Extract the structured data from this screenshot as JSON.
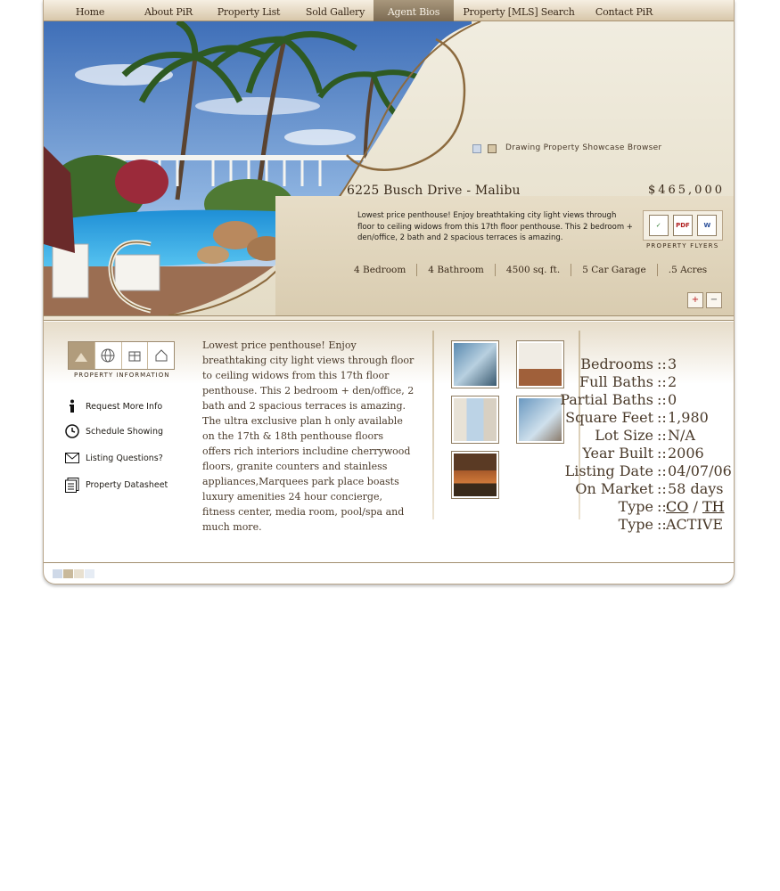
{
  "nav": {
    "items": [
      {
        "label": "Home"
      },
      {
        "label": "About PiR"
      },
      {
        "label": "Property List"
      },
      {
        "label": "Sold Gallery"
      },
      {
        "label": "Agent Bios"
      },
      {
        "label": "Property [MLS] Search"
      },
      {
        "label": "Contact PiR"
      }
    ],
    "active": "Agent Bios"
  },
  "hero": {
    "browser_label": "Drawing Property Showcase Browser",
    "address": "6225 Busch Drive - Malibu",
    "price": "$465,000",
    "short_description": "Lowest price penthouse! Enjoy breathtaking city light views through floor to ceiling widows from this 17th floor penthouse. This 2 bedroom + den/office, 2 bath and 2 spacious terraces is amazing.",
    "flyers_label": "PROPERTY FLYERS",
    "flyer_icons": [
      "print-icon",
      "pdf-icon",
      "word-icon"
    ],
    "specs": [
      "4 Bedroom",
      "4 Bathroom",
      "4500 sq. ft.",
      "5 Car Garage",
      ".5 Acres"
    ]
  },
  "sidebar": {
    "info_label": "PROPERTY INFORMATION",
    "links": [
      {
        "label": "Request More Info",
        "icon": "info-icon"
      },
      {
        "label": "Schedule Showing",
        "icon": "clock-icon"
      },
      {
        "label": "Listing Questions?",
        "icon": "envelope-icon"
      },
      {
        "label": "Property Datasheet",
        "icon": "datasheet-icon"
      }
    ]
  },
  "description": "Lowest price penthouse! Enjoy breathtaking city light views through floor to ceiling widows from this 17th floor penthouse. This 2 bedroom + den/office, 2 bath and 2 spacious terraces is amazing. The ultra exclusive plan h only available on the 17th & 18th penthouse floors offers rich interiors includine cherrywood floors, granite counters and stainless appliances,Marquees park place boasts luxury amenities 24 hour concierge, fitness center, media room, pool/spa and much more.",
  "facts": [
    {
      "key": "Bedrooms",
      "value": "3"
    },
    {
      "key": "Full Baths",
      "value": "2"
    },
    {
      "key": "Partial Baths",
      "value": "0"
    },
    {
      "key": "Square Feet",
      "value": "1,980"
    },
    {
      "key": "Lot Size",
      "value": "N/A"
    },
    {
      "key": "Year Built",
      "value": "2006"
    },
    {
      "key": "Listing Date",
      "value": "04/07/06"
    },
    {
      "key": "On Market",
      "value": "58 days"
    },
    {
      "key": "Type",
      "value_a": "CO",
      "sep": "/",
      "value_b": "TH"
    },
    {
      "key": "Type",
      "value": "ACTIVE"
    }
  ],
  "facts_separator": "::",
  "colors": {
    "accent": "#7b6a52",
    "beige": "#e6dcc9",
    "text": "#3a2a1a"
  }
}
